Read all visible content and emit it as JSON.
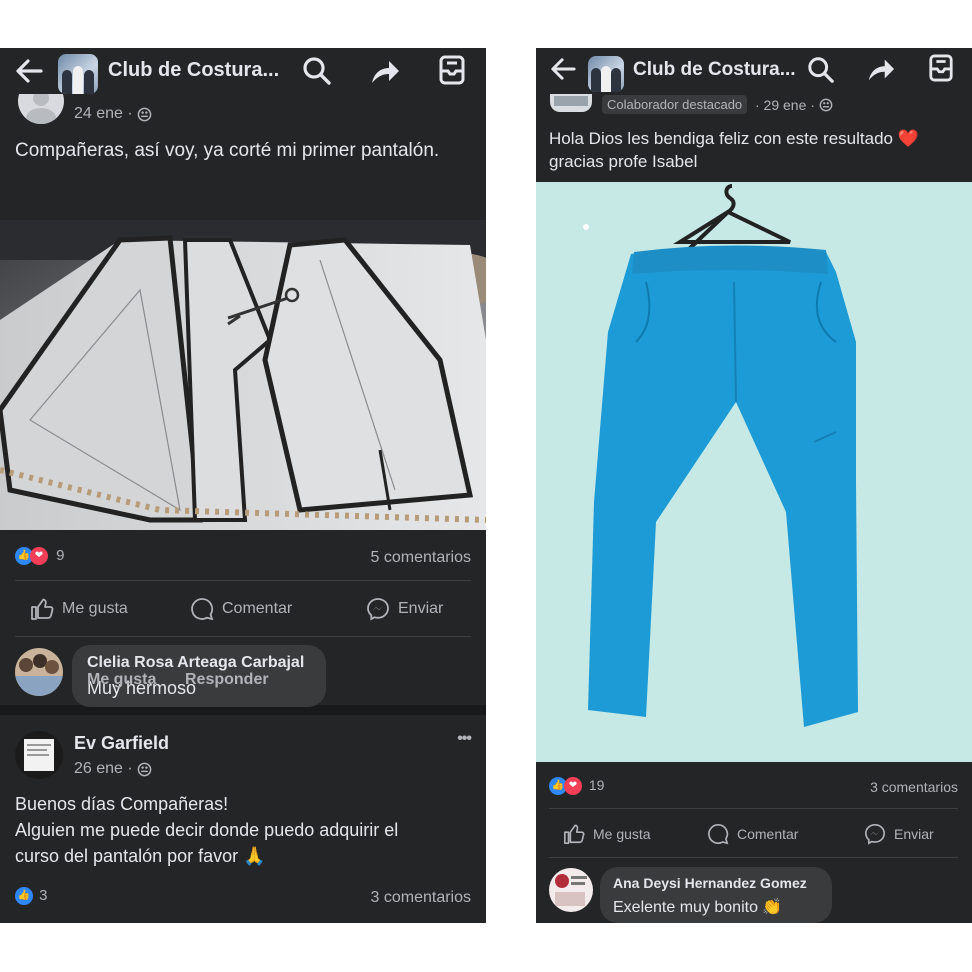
{
  "colors": {
    "background": "#18191a",
    "bar": "#242526",
    "accent": "#2d88ff",
    "love": "#f33e58"
  },
  "left": {
    "topbar": {
      "title": "Club de Costura..."
    },
    "post1": {
      "time": "24 ene ·",
      "text": "Compañeras,  así  voy, ya corté mi primer pantalón.",
      "reaction_count": "9",
      "comments": "5 comentarios"
    },
    "actions": {
      "like": "Me gusta",
      "comment": "Comentar",
      "send": "Enviar"
    },
    "comment1": {
      "author": "Clelia Rosa Arteaga Carbajal",
      "text": "Muy hermoso",
      "like": "Me gusta",
      "reply": "Responder"
    },
    "post2": {
      "author": "Ev Garfield",
      "time": "26 ene ·",
      "more": "•••",
      "line1": "Buenos días Compañeras!",
      "line2": "Alguien me puede decir donde puedo adquirir el",
      "line3": "curso del pantalón por favor 🙏",
      "reaction_count": "3",
      "comments": "3 comentarios"
    }
  },
  "right": {
    "topbar": {
      "title": "Club de Costura..."
    },
    "post": {
      "badge": "Colaborador destacado",
      "time": "· 29 ene ·",
      "line1": "Hola Dios les bendiga feliz con este resultado ❤️",
      "line2": "gracias profe Isabel",
      "reaction_count": "19",
      "comments": "3 comentarios"
    },
    "actions": {
      "like": "Me gusta",
      "comment": "Comentar",
      "send": "Enviar"
    },
    "comment1": {
      "author": "Ana Deysi Hernandez Gomez",
      "text": "Exelente muy bonito 👏"
    }
  }
}
